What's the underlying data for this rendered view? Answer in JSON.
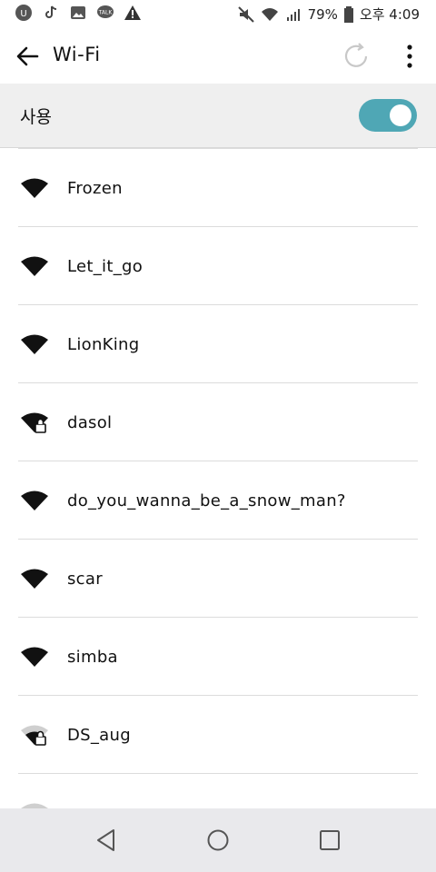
{
  "status_bar": {
    "battery_percent": "79%",
    "time": "오후 4:09",
    "left_icons": [
      "u-plus-icon",
      "tiktok-icon",
      "gallery-icon",
      "talk-icon",
      "warning-icon"
    ],
    "right_icons": [
      "mute-icon",
      "wifi-status-icon",
      "signal-icon",
      "battery-icon"
    ]
  },
  "app_bar": {
    "title": "Wi-Fi",
    "actions": [
      "back-arrow-icon",
      "refresh-icon",
      "more-vert-icon"
    ]
  },
  "toggle": {
    "label": "사용",
    "state": "on",
    "accent_color": "#4fa7b5"
  },
  "networks": [
    {
      "ssid": "Frozen",
      "secured": false,
      "signal": "full"
    },
    {
      "ssid": "Let_it_go",
      "secured": false,
      "signal": "full"
    },
    {
      "ssid": "LionKing",
      "secured": false,
      "signal": "full"
    },
    {
      "ssid": "dasol",
      "secured": true,
      "signal": "full"
    },
    {
      "ssid": "do_you_wanna_be_a_snow_man?",
      "secured": false,
      "signal": "full"
    },
    {
      "ssid": "scar",
      "secured": false,
      "signal": "full"
    },
    {
      "ssid": "simba",
      "secured": false,
      "signal": "full"
    },
    {
      "ssid": "DS_aug",
      "secured": true,
      "signal": "weak"
    }
  ],
  "nav_bar": {
    "buttons": [
      "back-triangle-icon",
      "home-circle-icon",
      "recents-square-icon"
    ]
  }
}
